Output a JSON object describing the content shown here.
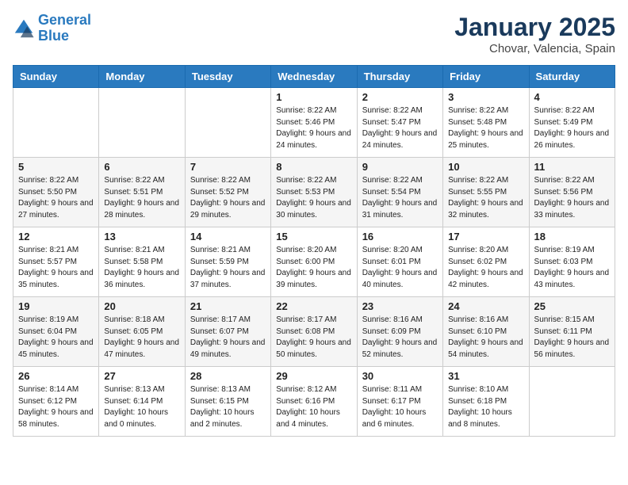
{
  "header": {
    "logo_line1": "General",
    "logo_line2": "Blue",
    "month": "January 2025",
    "location": "Chovar, Valencia, Spain"
  },
  "weekdays": [
    "Sunday",
    "Monday",
    "Tuesday",
    "Wednesday",
    "Thursday",
    "Friday",
    "Saturday"
  ],
  "weeks": [
    [
      {
        "day": "",
        "sunrise": "",
        "sunset": "",
        "daylight": ""
      },
      {
        "day": "",
        "sunrise": "",
        "sunset": "",
        "daylight": ""
      },
      {
        "day": "",
        "sunrise": "",
        "sunset": "",
        "daylight": ""
      },
      {
        "day": "1",
        "sunrise": "Sunrise: 8:22 AM",
        "sunset": "Sunset: 5:46 PM",
        "daylight": "Daylight: 9 hours and 24 minutes."
      },
      {
        "day": "2",
        "sunrise": "Sunrise: 8:22 AM",
        "sunset": "Sunset: 5:47 PM",
        "daylight": "Daylight: 9 hours and 24 minutes."
      },
      {
        "day": "3",
        "sunrise": "Sunrise: 8:22 AM",
        "sunset": "Sunset: 5:48 PM",
        "daylight": "Daylight: 9 hours and 25 minutes."
      },
      {
        "day": "4",
        "sunrise": "Sunrise: 8:22 AM",
        "sunset": "Sunset: 5:49 PM",
        "daylight": "Daylight: 9 hours and 26 minutes."
      }
    ],
    [
      {
        "day": "5",
        "sunrise": "Sunrise: 8:22 AM",
        "sunset": "Sunset: 5:50 PM",
        "daylight": "Daylight: 9 hours and 27 minutes."
      },
      {
        "day": "6",
        "sunrise": "Sunrise: 8:22 AM",
        "sunset": "Sunset: 5:51 PM",
        "daylight": "Daylight: 9 hours and 28 minutes."
      },
      {
        "day": "7",
        "sunrise": "Sunrise: 8:22 AM",
        "sunset": "Sunset: 5:52 PM",
        "daylight": "Daylight: 9 hours and 29 minutes."
      },
      {
        "day": "8",
        "sunrise": "Sunrise: 8:22 AM",
        "sunset": "Sunset: 5:53 PM",
        "daylight": "Daylight: 9 hours and 30 minutes."
      },
      {
        "day": "9",
        "sunrise": "Sunrise: 8:22 AM",
        "sunset": "Sunset: 5:54 PM",
        "daylight": "Daylight: 9 hours and 31 minutes."
      },
      {
        "day": "10",
        "sunrise": "Sunrise: 8:22 AM",
        "sunset": "Sunset: 5:55 PM",
        "daylight": "Daylight: 9 hours and 32 minutes."
      },
      {
        "day": "11",
        "sunrise": "Sunrise: 8:22 AM",
        "sunset": "Sunset: 5:56 PM",
        "daylight": "Daylight: 9 hours and 33 minutes."
      }
    ],
    [
      {
        "day": "12",
        "sunrise": "Sunrise: 8:21 AM",
        "sunset": "Sunset: 5:57 PM",
        "daylight": "Daylight: 9 hours and 35 minutes."
      },
      {
        "day": "13",
        "sunrise": "Sunrise: 8:21 AM",
        "sunset": "Sunset: 5:58 PM",
        "daylight": "Daylight: 9 hours and 36 minutes."
      },
      {
        "day": "14",
        "sunrise": "Sunrise: 8:21 AM",
        "sunset": "Sunset: 5:59 PM",
        "daylight": "Daylight: 9 hours and 37 minutes."
      },
      {
        "day": "15",
        "sunrise": "Sunrise: 8:20 AM",
        "sunset": "Sunset: 6:00 PM",
        "daylight": "Daylight: 9 hours and 39 minutes."
      },
      {
        "day": "16",
        "sunrise": "Sunrise: 8:20 AM",
        "sunset": "Sunset: 6:01 PM",
        "daylight": "Daylight: 9 hours and 40 minutes."
      },
      {
        "day": "17",
        "sunrise": "Sunrise: 8:20 AM",
        "sunset": "Sunset: 6:02 PM",
        "daylight": "Daylight: 9 hours and 42 minutes."
      },
      {
        "day": "18",
        "sunrise": "Sunrise: 8:19 AM",
        "sunset": "Sunset: 6:03 PM",
        "daylight": "Daylight: 9 hours and 43 minutes."
      }
    ],
    [
      {
        "day": "19",
        "sunrise": "Sunrise: 8:19 AM",
        "sunset": "Sunset: 6:04 PM",
        "daylight": "Daylight: 9 hours and 45 minutes."
      },
      {
        "day": "20",
        "sunrise": "Sunrise: 8:18 AM",
        "sunset": "Sunset: 6:05 PM",
        "daylight": "Daylight: 9 hours and 47 minutes."
      },
      {
        "day": "21",
        "sunrise": "Sunrise: 8:17 AM",
        "sunset": "Sunset: 6:07 PM",
        "daylight": "Daylight: 9 hours and 49 minutes."
      },
      {
        "day": "22",
        "sunrise": "Sunrise: 8:17 AM",
        "sunset": "Sunset: 6:08 PM",
        "daylight": "Daylight: 9 hours and 50 minutes."
      },
      {
        "day": "23",
        "sunrise": "Sunrise: 8:16 AM",
        "sunset": "Sunset: 6:09 PM",
        "daylight": "Daylight: 9 hours and 52 minutes."
      },
      {
        "day": "24",
        "sunrise": "Sunrise: 8:16 AM",
        "sunset": "Sunset: 6:10 PM",
        "daylight": "Daylight: 9 hours and 54 minutes."
      },
      {
        "day": "25",
        "sunrise": "Sunrise: 8:15 AM",
        "sunset": "Sunset: 6:11 PM",
        "daylight": "Daylight: 9 hours and 56 minutes."
      }
    ],
    [
      {
        "day": "26",
        "sunrise": "Sunrise: 8:14 AM",
        "sunset": "Sunset: 6:12 PM",
        "daylight": "Daylight: 9 hours and 58 minutes."
      },
      {
        "day": "27",
        "sunrise": "Sunrise: 8:13 AM",
        "sunset": "Sunset: 6:14 PM",
        "daylight": "Daylight: 10 hours and 0 minutes."
      },
      {
        "day": "28",
        "sunrise": "Sunrise: 8:13 AM",
        "sunset": "Sunset: 6:15 PM",
        "daylight": "Daylight: 10 hours and 2 minutes."
      },
      {
        "day": "29",
        "sunrise": "Sunrise: 8:12 AM",
        "sunset": "Sunset: 6:16 PM",
        "daylight": "Daylight: 10 hours and 4 minutes."
      },
      {
        "day": "30",
        "sunrise": "Sunrise: 8:11 AM",
        "sunset": "Sunset: 6:17 PM",
        "daylight": "Daylight: 10 hours and 6 minutes."
      },
      {
        "day": "31",
        "sunrise": "Sunrise: 8:10 AM",
        "sunset": "Sunset: 6:18 PM",
        "daylight": "Daylight: 10 hours and 8 minutes."
      },
      {
        "day": "",
        "sunrise": "",
        "sunset": "",
        "daylight": ""
      }
    ]
  ]
}
